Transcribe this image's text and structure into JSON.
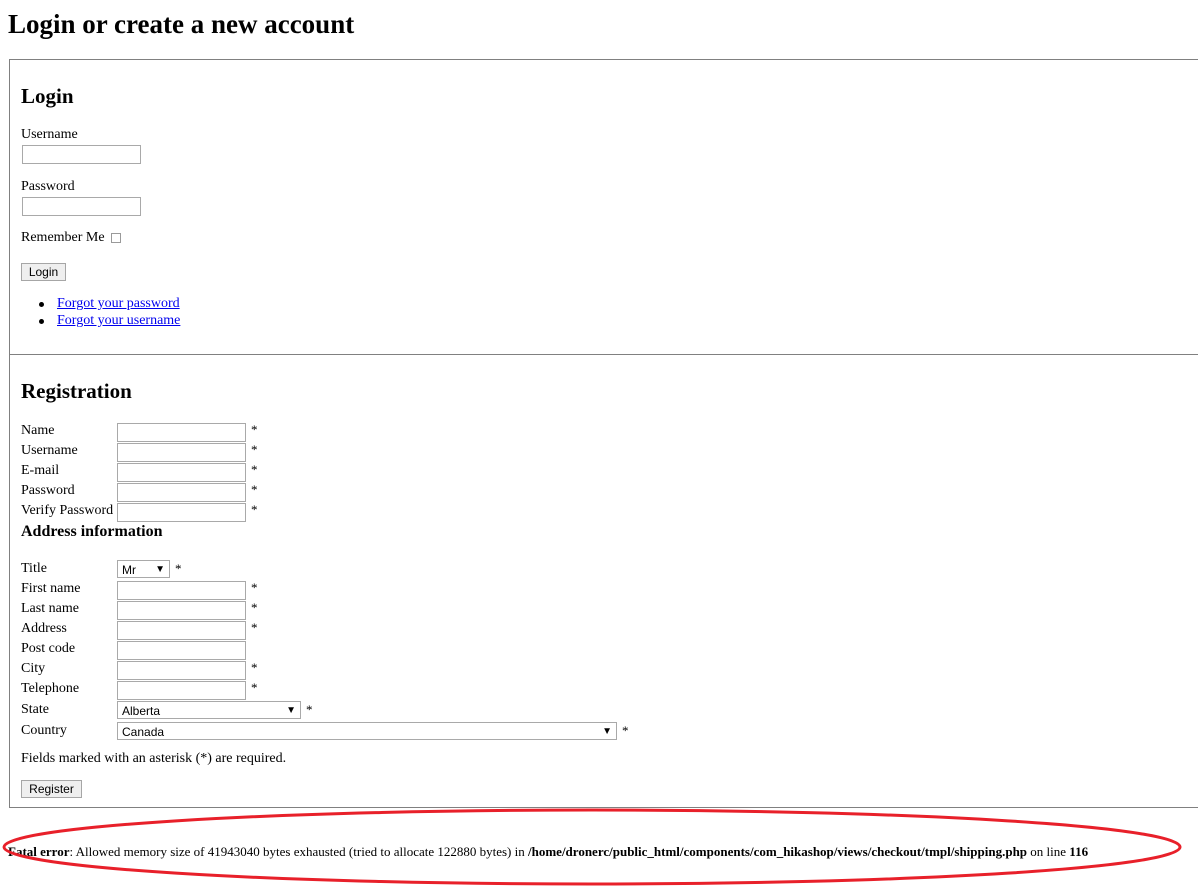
{
  "page_title": "Login or create a new account",
  "login": {
    "heading": "Login",
    "username_label": "Username",
    "username_value": "",
    "password_label": "Password",
    "password_value": "",
    "remember_label": "Remember Me",
    "remember_checked": false,
    "login_button": "Login",
    "links": [
      "Forgot your password",
      "Forgot your username"
    ]
  },
  "registration": {
    "heading": "Registration",
    "required_mark": "*",
    "fields": [
      {
        "label": "Name",
        "value": "",
        "required": true
      },
      {
        "label": "Username",
        "value": "",
        "required": true
      },
      {
        "label": "E-mail",
        "value": "",
        "required": true
      },
      {
        "label": "Password",
        "value": "",
        "required": true
      },
      {
        "label": "Verify Password",
        "value": "",
        "required": true
      }
    ],
    "address_heading": "Address information",
    "title_label": "Title",
    "title_value": "Mr",
    "address_fields": [
      {
        "label": "First name",
        "value": "",
        "required": true
      },
      {
        "label": "Last name",
        "value": "",
        "required": true
      },
      {
        "label": "Address",
        "value": "",
        "required": true
      },
      {
        "label": "Post code",
        "value": "",
        "required": false
      },
      {
        "label": "City",
        "value": "",
        "required": true
      },
      {
        "label": "Telephone",
        "value": "",
        "required": true
      }
    ],
    "state_label": "State",
    "state_value": "Alberta",
    "country_label": "Country",
    "country_value": "Canada",
    "required_note": "Fields marked with an asterisk (*) are required.",
    "register_button": "Register"
  },
  "error": {
    "label": "Fatal error",
    "message": ": Allowed memory size of 41943040 bytes exhausted (tried to allocate 122880 bytes) in ",
    "path": "/home/dronerc/public_html/components/com_hikashop/views/checkout/tmpl/shipping.php",
    "line_text": " on line ",
    "line_number": "116",
    "annotation_color": "#e8202a"
  }
}
